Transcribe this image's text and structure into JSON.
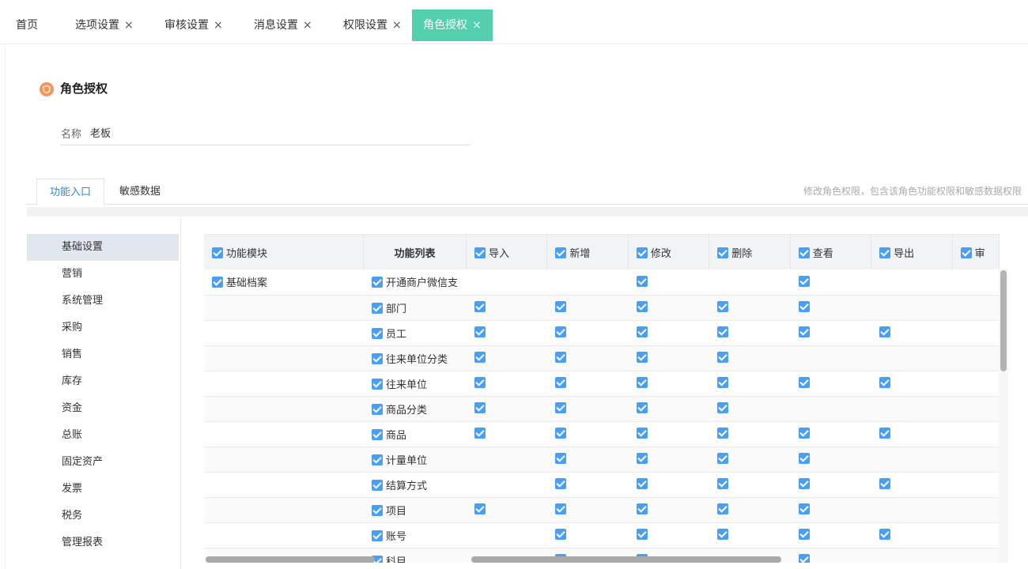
{
  "tabs": [
    {
      "label": "首页",
      "closable": false
    },
    {
      "label": "选项设置",
      "closable": true
    },
    {
      "label": "审核设置",
      "closable": true
    },
    {
      "label": "消息设置",
      "closable": true
    },
    {
      "label": "权限设置",
      "closable": true
    },
    {
      "label": "角色授权",
      "closable": true,
      "active": true
    }
  ],
  "close_glyph": "×",
  "page": {
    "title": "角色授权",
    "title_icon": "shield-icon",
    "name_label": "名称",
    "name_value": "老板"
  },
  "subtabs": [
    {
      "label": "功能入口",
      "active": true
    },
    {
      "label": "敏感数据",
      "active": false
    }
  ],
  "hint": "修改角色权限，包含该角色功能权限和敏感数据权限",
  "sidebar": [
    {
      "label": "基础设置",
      "active": true
    },
    {
      "label": "营销"
    },
    {
      "label": "系统管理"
    },
    {
      "label": "采购"
    },
    {
      "label": "销售"
    },
    {
      "label": "库存"
    },
    {
      "label": "资金"
    },
    {
      "label": "总账"
    },
    {
      "label": "固定资产"
    },
    {
      "label": "发票"
    },
    {
      "label": "税务"
    },
    {
      "label": "管理报表"
    }
  ],
  "table": {
    "headers": {
      "module": "功能模块",
      "list": "功能列表",
      "ops": [
        "导入",
        "新增",
        "修改",
        "删除",
        "查看",
        "导出",
        "审"
      ]
    },
    "rows": [
      {
        "module": "基础档案",
        "item": "开通商户微信支",
        "ops": [
          false,
          false,
          true,
          false,
          true,
          false,
          false
        ]
      },
      {
        "module": "",
        "item": "部门",
        "ops": [
          true,
          true,
          true,
          true,
          true,
          false,
          false
        ]
      },
      {
        "module": "",
        "item": "员工",
        "ops": [
          true,
          true,
          true,
          true,
          true,
          true,
          false
        ]
      },
      {
        "module": "",
        "item": "往来单位分类",
        "ops": [
          true,
          true,
          true,
          true,
          false,
          false,
          false
        ]
      },
      {
        "module": "",
        "item": "往来单位",
        "ops": [
          true,
          true,
          true,
          true,
          true,
          true,
          false
        ]
      },
      {
        "module": "",
        "item": "商品分类",
        "ops": [
          true,
          true,
          true,
          true,
          false,
          false,
          false
        ]
      },
      {
        "module": "",
        "item": "商品",
        "ops": [
          true,
          true,
          true,
          true,
          true,
          true,
          false
        ]
      },
      {
        "module": "",
        "item": "计量单位",
        "ops": [
          false,
          true,
          true,
          true,
          true,
          false,
          false
        ]
      },
      {
        "module": "",
        "item": "结算方式",
        "ops": [
          false,
          true,
          true,
          true,
          true,
          true,
          false
        ]
      },
      {
        "module": "",
        "item": "项目",
        "ops": [
          true,
          true,
          true,
          true,
          true,
          false,
          false
        ]
      },
      {
        "module": "",
        "item": "账号",
        "ops": [
          false,
          true,
          true,
          true,
          true,
          true,
          false
        ]
      },
      {
        "module": "",
        "item": "科目",
        "ops": [
          false,
          true,
          true,
          false,
          true,
          false,
          false
        ]
      }
    ]
  }
}
